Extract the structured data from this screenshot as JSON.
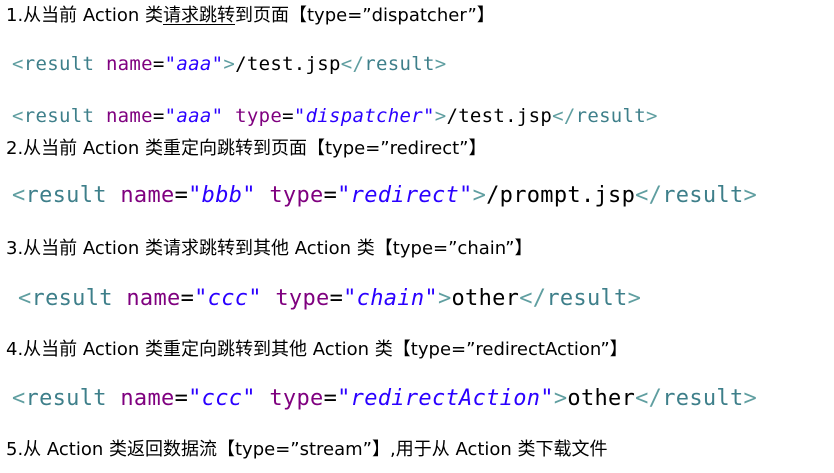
{
  "sections": [
    {
      "heading": {
        "prefix": "1.从当前 Action 类",
        "underlined": "请求跳转",
        "suffix": "到页面【type=”dispatcher”】"
      },
      "lines": [
        {
          "tag": "result",
          "attrs": [
            {
              "name": "name",
              "value": "\"aaa\""
            }
          ],
          "text": "/test.jsp"
        },
        {
          "tag": "result",
          "attrs": [
            {
              "name": "name",
              "value": "\"aaa\""
            },
            {
              "name": "type",
              "value": "\"dispatcher\""
            }
          ],
          "text": "/test.jsp"
        }
      ]
    },
    {
      "heading": {
        "prefix": "2.从当前 Action 类重定向跳转到页面【type=”redirect”】"
      },
      "lines": [
        {
          "tag": "result",
          "attrs": [
            {
              "name": "name",
              "value": "\"bbb\""
            },
            {
              "name": "type",
              "value": "\"redirect\""
            }
          ],
          "text": "/prompt.jsp"
        }
      ]
    },
    {
      "heading": {
        "prefix": "3.从当前 Action 类请求跳转到其他 Action 类【type=”chain”】"
      },
      "lines": [
        {
          "tag": "result",
          "attrs": [
            {
              "name": "name",
              "value": "\"ccc\""
            },
            {
              "name": "type",
              "value": "\"chain\""
            }
          ],
          "text": "other"
        }
      ]
    },
    {
      "heading": {
        "prefix": "4.从当前 Action 类重定向跳转到其他 Action 类【type=”redirectAction”】"
      },
      "lines": [
        {
          "tag": "result",
          "attrs": [
            {
              "name": "name",
              "value": "\"ccc\""
            },
            {
              "name": "type",
              "value": "\"redirectAction\""
            }
          ],
          "text": "other"
        }
      ]
    },
    {
      "heading": {
        "prefix": "5.从 Action 类返回数据流【type=”stream”】,用于从 Action 类下载文件"
      },
      "lines": []
    }
  ],
  "colors": {
    "bracket": "#5f9ea0",
    "tag": "#3e7f8a",
    "attribute": "#7f007f",
    "value": "#2a00ff",
    "text": "#000000"
  }
}
